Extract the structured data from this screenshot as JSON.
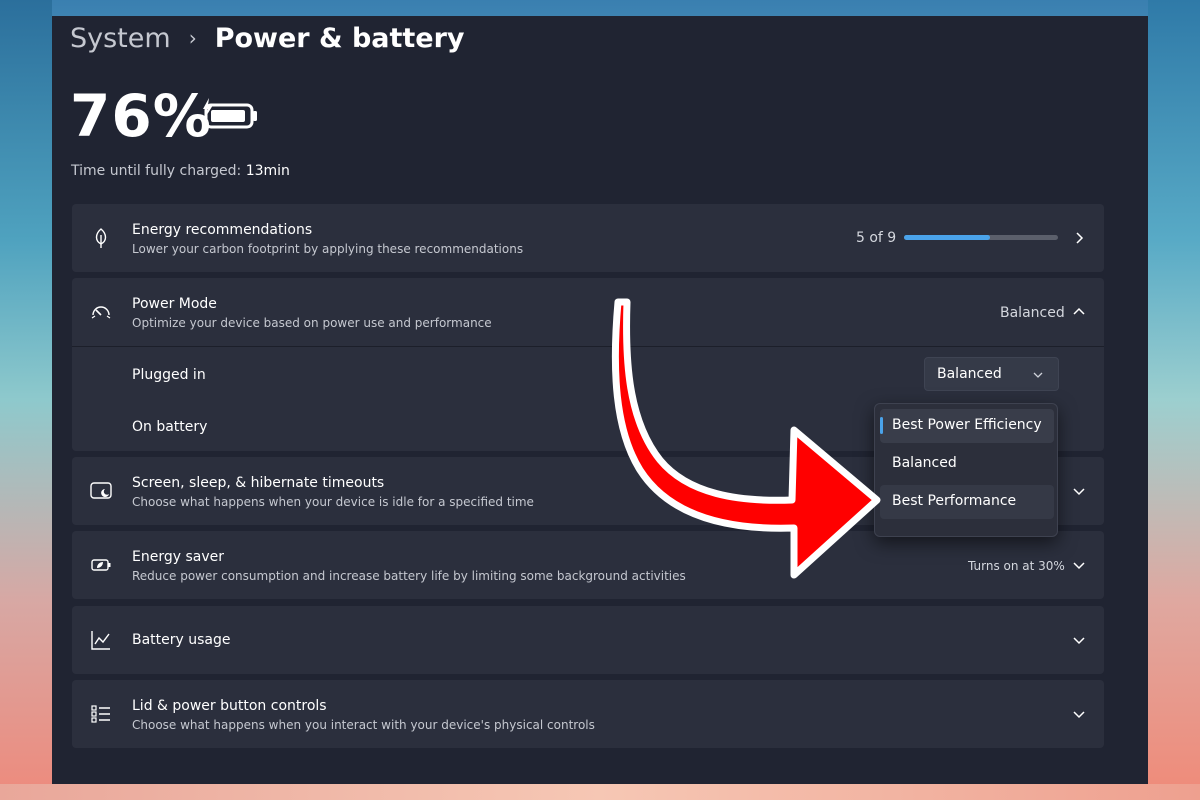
{
  "header": {
    "breadcrumb_parent": "System",
    "breadcrumb_separator": "›",
    "title": "Power & battery"
  },
  "battery": {
    "percent_text": "76%",
    "charge_label": "Time until fully charged:",
    "charge_value": "13min"
  },
  "rows": {
    "energy_recommendations": {
      "title": "Energy recommendations",
      "subtitle": "Lower your carbon footprint by applying these recommendations",
      "progress_text": "5 of 9",
      "progress_fraction": 0.56,
      "icon": "leaf-icon"
    },
    "power_mode": {
      "title": "Power Mode",
      "subtitle": "Optimize your device based on power use and performance",
      "value": "Balanced",
      "icon": "gauge-icon",
      "plugged_in_label": "Plugged in",
      "plugged_in_value": "Balanced",
      "on_battery_label": "On battery"
    },
    "screen_sleep": {
      "title": "Screen, sleep, & hibernate timeouts",
      "subtitle": "Choose what happens when your device is idle for a specified time",
      "icon": "screen-sleep-icon"
    },
    "energy_saver": {
      "title": "Energy saver",
      "subtitle": "Reduce power consumption and increase battery life by limiting some background activities",
      "value": "Turns on at 30%",
      "icon": "battery-leaf-icon"
    },
    "battery_usage": {
      "title": "Battery usage",
      "icon": "chart-line-icon"
    },
    "lid_power": {
      "title": "Lid & power button controls",
      "subtitle": "Choose what happens when you interact with your device's physical controls",
      "icon": "list-icon"
    }
  },
  "dropdown": {
    "options": [
      "Best Power Efficiency",
      "Balanced",
      "Best Performance"
    ],
    "selected": "Best Power Efficiency",
    "hovered": "Best Performance"
  },
  "colors": {
    "accent": "#4aa3ea",
    "window_bg": "#202432",
    "card_bg": "#2b2f3d",
    "arrow_red": "#ff0000"
  }
}
